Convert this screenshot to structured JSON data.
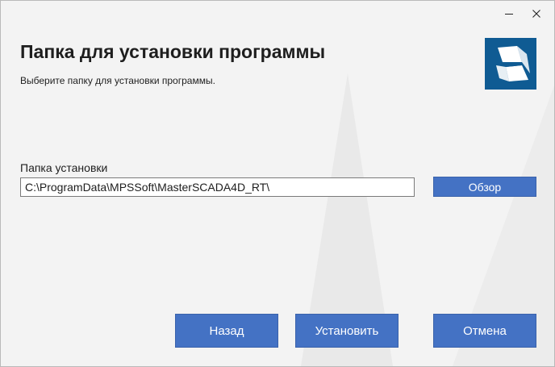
{
  "window": {
    "minimize_icon": "minimize-icon",
    "close_icon": "close-icon"
  },
  "header": {
    "title": "Папка для установки программы",
    "subtitle": "Выберите папку для установки программы.",
    "logo_icon": "masterscada-logo-icon"
  },
  "install_folder": {
    "label": "Папка установки",
    "value": "C:\\ProgramData\\MPSSoft\\MasterSCADA4D_RT\\",
    "browse_label": "Обзор"
  },
  "buttons": {
    "back_label": "Назад",
    "install_label": "Установить",
    "cancel_label": "Отмена"
  },
  "colors": {
    "accent": "#4472c4",
    "logo_background": "#0f5b93",
    "window_background": "#f3f3f3"
  }
}
